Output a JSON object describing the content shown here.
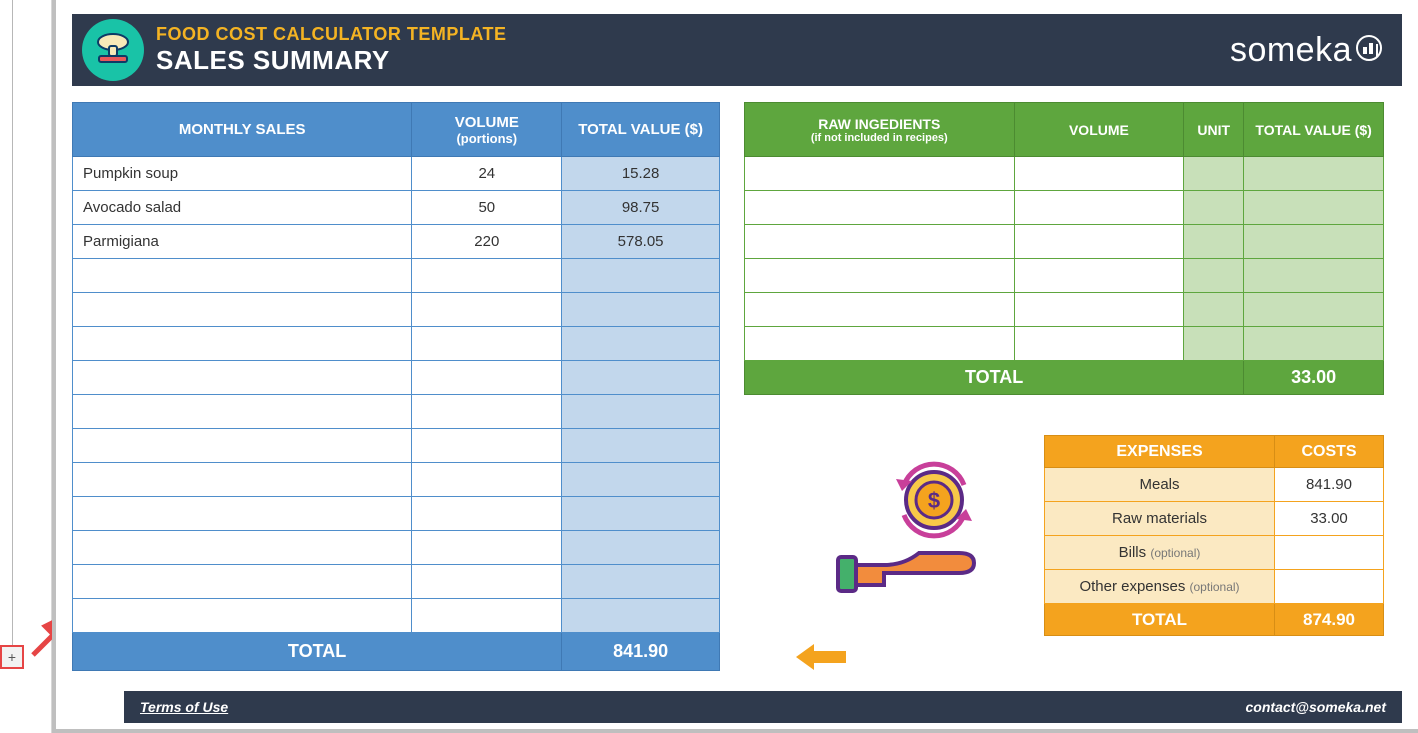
{
  "header": {
    "title": "FOOD COST CALCULATOR TEMPLATE",
    "subtitle": "SALES SUMMARY",
    "brand": "someka"
  },
  "monthly_sales": {
    "header_sales": "MONTHLY SALES",
    "header_volume": "VOLUME",
    "header_volume_sub": "(portions)",
    "header_total": "TOTAL VALUE ($)",
    "rows": [
      {
        "name": "Pumpkin soup",
        "volume": "24",
        "value": "15.28"
      },
      {
        "name": "Avocado salad",
        "volume": "50",
        "value": "98.75"
      },
      {
        "name": "Parmigiana",
        "volume": "220",
        "value": "578.05"
      }
    ],
    "total_label": "TOTAL",
    "total_value": "841.90"
  },
  "raw_ingredients": {
    "header_name": "RAW INGEDIENTS",
    "header_name_sub": "(if not included in recipes)",
    "header_volume": "VOLUME",
    "header_unit": "UNIT",
    "header_total": "TOTAL VALUE ($)",
    "total_label": "TOTAL",
    "total_value": "33.00"
  },
  "expenses": {
    "header_expenses": "EXPENSES",
    "header_costs": "COSTS",
    "rows": [
      {
        "label": "Meals",
        "opt": "",
        "cost": "841.90"
      },
      {
        "label": "Raw materials",
        "opt": "",
        "cost": "33.00"
      },
      {
        "label": "Bills",
        "opt": "(optional)",
        "cost": ""
      },
      {
        "label": "Other expenses",
        "opt": "(optional)",
        "cost": ""
      }
    ],
    "total_label": "TOTAL",
    "total_value": "874.90"
  },
  "footer": {
    "terms": "Terms of Use",
    "contact": "contact@someka.net"
  },
  "outline": {
    "expand_symbol": "+"
  }
}
